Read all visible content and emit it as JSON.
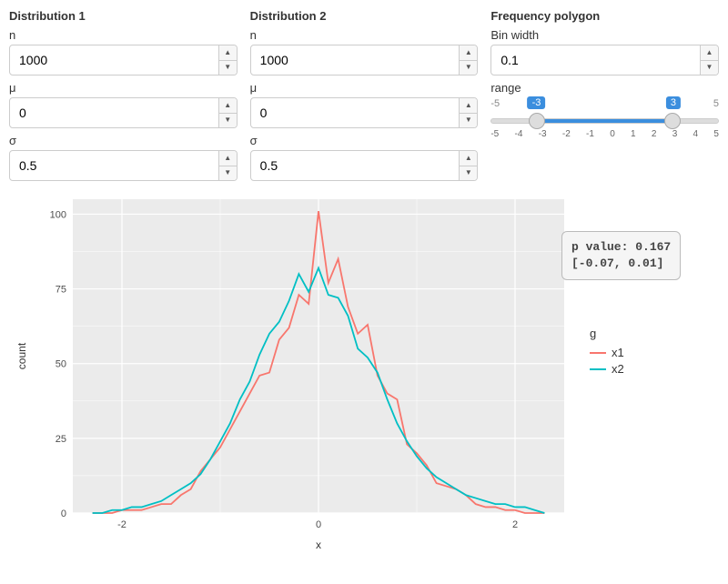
{
  "controls": {
    "dist1": {
      "heading": "Distribution 1",
      "n_label": "n",
      "n": "1000",
      "mu_label": "μ",
      "mu": "0",
      "sigma_label": "σ",
      "sigma": "0.5"
    },
    "dist2": {
      "heading": "Distribution 2",
      "n_label": "n",
      "n": "1000",
      "mu_label": "μ",
      "mu": "0",
      "sigma_label": "σ",
      "sigma": "0.5"
    },
    "freq": {
      "heading": "Frequency polygon",
      "binwidth_label": "Bin width",
      "binwidth": "0.1",
      "range_label": "range",
      "range_min": "-5",
      "range_max": "5",
      "range_low": "-3",
      "range_high": "3",
      "ticks": [
        "-5",
        "-4",
        "-3",
        "-2",
        "-1",
        "0",
        "1",
        "2",
        "3",
        "4",
        "5"
      ]
    }
  },
  "stats": {
    "line1": "p value: 0.167",
    "line2": "[-0.07, 0.01]"
  },
  "legend": {
    "title": "g",
    "x1": "x1",
    "x2": "x2"
  },
  "colors": {
    "x1": "#F8766D",
    "x2": "#00BFC4"
  },
  "chart_data": {
    "type": "line",
    "title": "",
    "xlabel": "x",
    "ylabel": "count",
    "xlim": [
      -2.5,
      2.5
    ],
    "ylim": [
      0,
      105
    ],
    "xticks": [
      -2,
      0,
      2
    ],
    "yticks": [
      0,
      25,
      50,
      75,
      100
    ],
    "legend_position": "right",
    "grid": true,
    "x": [
      -2.3,
      -2.2,
      -2.1,
      -2.0,
      -1.9,
      -1.8,
      -1.7,
      -1.6,
      -1.5,
      -1.4,
      -1.3,
      -1.2,
      -1.1,
      -1.0,
      -0.9,
      -0.8,
      -0.7,
      -0.6,
      -0.5,
      -0.4,
      -0.3,
      -0.2,
      -0.1,
      0.0,
      0.1,
      0.2,
      0.3,
      0.4,
      0.5,
      0.6,
      0.7,
      0.8,
      0.9,
      1.0,
      1.1,
      1.2,
      1.3,
      1.4,
      1.5,
      1.6,
      1.7,
      1.8,
      1.9,
      2.0,
      2.1,
      2.2,
      2.3
    ],
    "series": [
      {
        "name": "x1",
        "color": "#F8766D",
        "values": [
          0,
          0,
          0,
          1,
          1,
          1,
          2,
          3,
          3,
          6,
          8,
          14,
          18,
          22,
          28,
          34,
          40,
          46,
          47,
          58,
          62,
          73,
          70,
          101,
          77,
          85,
          69,
          60,
          63,
          46,
          40,
          38,
          23,
          20,
          16,
          10,
          9,
          8,
          6,
          3,
          2,
          2,
          1,
          1,
          0,
          0,
          0
        ]
      },
      {
        "name": "x2",
        "color": "#00BFC4",
        "values": [
          0,
          0,
          1,
          1,
          2,
          2,
          3,
          4,
          6,
          8,
          10,
          13,
          18,
          24,
          30,
          38,
          44,
          53,
          60,
          64,
          71,
          80,
          74,
          82,
          73,
          72,
          66,
          55,
          52,
          47,
          38,
          30,
          24,
          19,
          15,
          12,
          10,
          8,
          6,
          5,
          4,
          3,
          3,
          2,
          2,
          1,
          0
        ]
      }
    ]
  }
}
